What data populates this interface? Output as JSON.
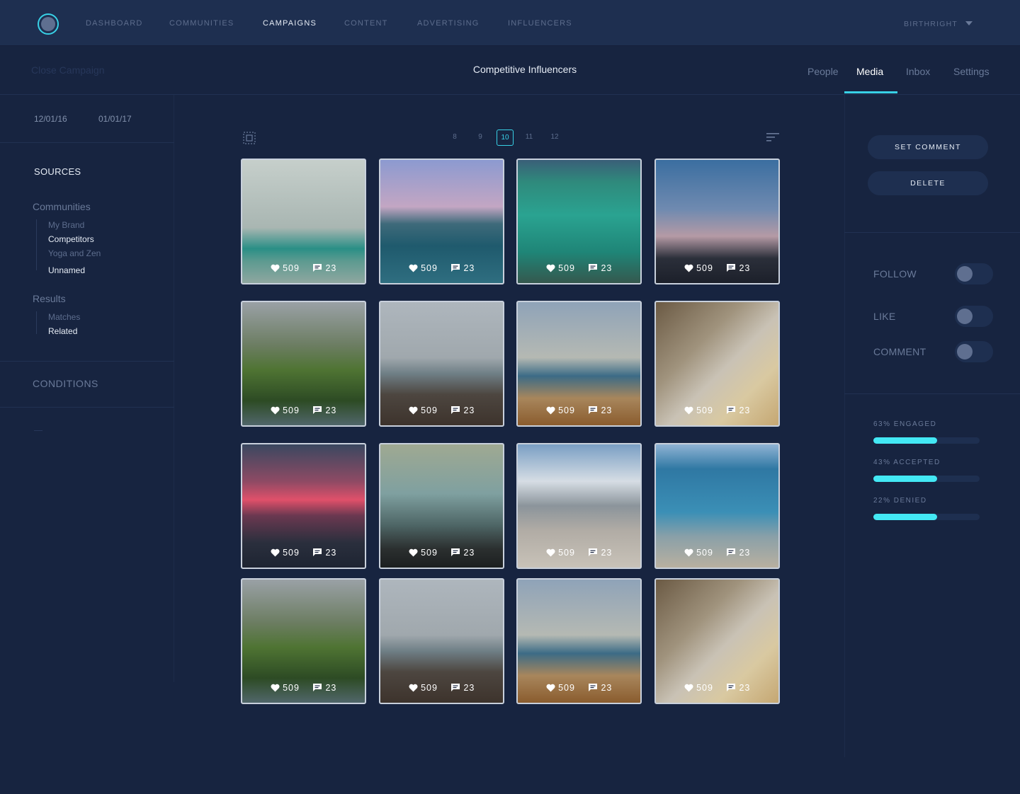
{
  "nav": {
    "items": [
      {
        "label": "DASHBOARD",
        "active": false
      },
      {
        "label": "COMMUNITIES",
        "active": false
      },
      {
        "label": "CAMPAIGNS",
        "active": true
      },
      {
        "label": "CONTENT",
        "active": false
      },
      {
        "label": "ADVERTISING",
        "active": false
      },
      {
        "label": "INFLUENCERS",
        "active": false
      }
    ],
    "account": "BIRTHRIGHT"
  },
  "subheader": {
    "close_label": "Close Campaign",
    "title": "Competitive Influencers",
    "tabs": [
      {
        "label": "People",
        "active": false
      },
      {
        "label": "Media",
        "active": true
      },
      {
        "label": "Inbox",
        "active": false
      },
      {
        "label": "Settings",
        "active": false
      }
    ]
  },
  "sidebar": {
    "date_start": "12/01/16",
    "date_end": "01/01/17",
    "sources_title": "SOURCES",
    "communities": {
      "title": "Communities",
      "items": [
        {
          "label": "My Brand",
          "selected": false
        },
        {
          "label": "Competitors",
          "selected": true
        },
        {
          "label": "Yoga and Zen",
          "selected": false
        },
        {
          "label": "Unnamed",
          "selected": true
        }
      ]
    },
    "results": {
      "title": "Results",
      "items": [
        {
          "label": "Matches",
          "selected": false
        },
        {
          "label": "Related",
          "selected": true
        }
      ]
    },
    "conditions": "CONDITIONS"
  },
  "pagination": {
    "pages": [
      "8",
      "9",
      "10",
      "11",
      "12"
    ],
    "current": "10"
  },
  "media": [
    {
      "likes": "509",
      "comments": "23",
      "photo": "surf"
    },
    {
      "likes": "509",
      "comments": "23",
      "photo": "pier"
    },
    {
      "likes": "509",
      "comments": "23",
      "photo": "pool"
    },
    {
      "likes": "509",
      "comments": "23",
      "photo": "dusk"
    },
    {
      "likes": "509",
      "comments": "23",
      "photo": "cliff"
    },
    {
      "likes": "509",
      "comments": "23",
      "photo": "shore"
    },
    {
      "likes": "509",
      "comments": "23",
      "photo": "sand"
    },
    {
      "likes": "509",
      "comments": "23",
      "photo": "shoes"
    },
    {
      "likes": "509",
      "comments": "23",
      "photo": "red"
    },
    {
      "likes": "509",
      "comments": "23",
      "photo": "silh"
    },
    {
      "likes": "509",
      "comments": "23",
      "photo": "city"
    },
    {
      "likes": "509",
      "comments": "23",
      "photo": "umb"
    },
    {
      "likes": "509",
      "comments": "23",
      "photo": "cliff"
    },
    {
      "likes": "509",
      "comments": "23",
      "photo": "shore"
    },
    {
      "likes": "509",
      "comments": "23",
      "photo": "sand"
    },
    {
      "likes": "509",
      "comments": "23",
      "photo": "shoes"
    }
  ],
  "actions": {
    "set_comment": "SET COMMENT",
    "delete": "DELETE"
  },
  "toggles": [
    {
      "label": "FOLLOW",
      "on": false
    },
    {
      "label": "LIKE",
      "on": false
    },
    {
      "label": "COMMENT",
      "on": false
    }
  ],
  "stats": [
    {
      "label": "63% ENGAGED",
      "fill": 0.6
    },
    {
      "label": "43% ACCEPTED",
      "fill": 0.6
    },
    {
      "label": "22% DENIED",
      "fill": 0.6
    }
  ],
  "colors": {
    "accent": "#38d1e6",
    "bar": "#43e8f4",
    "background": "#172440",
    "nav": "#1e2f50"
  }
}
